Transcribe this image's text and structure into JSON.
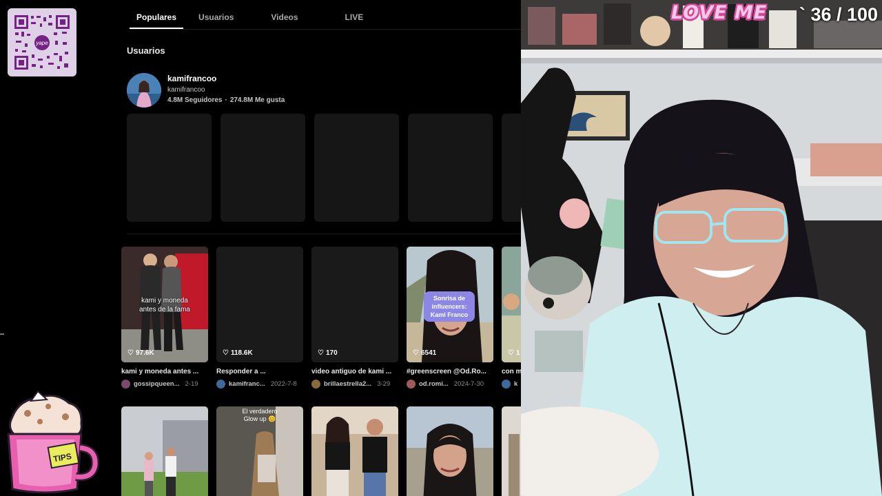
{
  "browser": {
    "tabs": [
      {
        "label": "Populares",
        "active": true
      },
      {
        "label": "Usuarios",
        "active": false
      },
      {
        "label": "Videos",
        "active": false
      },
      {
        "label": "LIVE",
        "active": false
      }
    ],
    "users_section_title": "Usuarios",
    "user": {
      "name": "kamifrancoo",
      "handle": "kamifrancoo",
      "followers": "4.8M Seguidores",
      "likes": "274.8M Me gusta",
      "separator": "·"
    },
    "videos_row1": [
      {
        "likes": "97.6K",
        "overlay": "kami y moneda\nantes de la fama",
        "title": "kami y moneda antes ...",
        "author": "gossipqueen...",
        "date": "2-19"
      },
      {
        "likes": "118.6K",
        "overlay": "",
        "title": "Responder a ...",
        "author": "kamifranc...",
        "date": "2022-7-8"
      },
      {
        "likes": "170",
        "overlay": "",
        "title": "video antiguo de kami ...",
        "author": "brillaestrella2...",
        "date": "3-29"
      },
      {
        "likes": "6541",
        "overlay": "Sonrisa de influencers: Kami Franco",
        "title": "#greenscreen @Od.Ro...",
        "author": "od.romi...",
        "date": "2024-7-30"
      },
      {
        "likes": "1",
        "overlay": "",
        "title": "con m",
        "author": "k",
        "date": ""
      }
    ],
    "videos_row2": [
      {
        "caption": ""
      },
      {
        "caption": "El verdadero\nGlow up 😊"
      },
      {
        "caption": ""
      },
      {
        "caption": ""
      },
      {
        "caption": ""
      }
    ],
    "heart_icon": "♡"
  },
  "overlay": {
    "qr_brand": "yape",
    "tips_label": "TIPS",
    "love_me": "LOVE ME",
    "goal_counter": "` 36 / 100"
  },
  "colors": {
    "background": "#000000",
    "placeholder": "#161616",
    "bubble": "#8c86e6",
    "love_me_fill": "#f7c8e8",
    "love_me_outline": "#d3489a",
    "qr_purple": "#742284"
  }
}
